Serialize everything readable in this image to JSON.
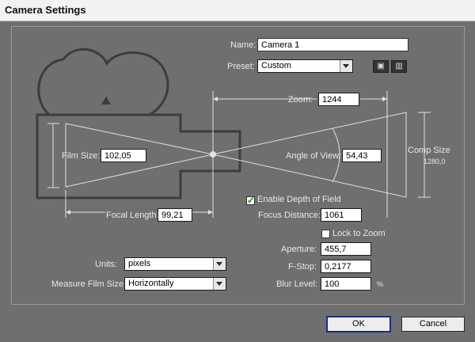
{
  "window": {
    "title": "Camera Settings"
  },
  "name": {
    "label": "Name:",
    "value": "Camera 1"
  },
  "preset": {
    "label": "Preset:",
    "value": "Custom",
    "save_icon": "disk-icon",
    "delete_icon": "trash-icon"
  },
  "zoom": {
    "label": "Zoom:",
    "value": "1244"
  },
  "film_size": {
    "label": "Film Size:",
    "value": "102,05"
  },
  "angle_of_view": {
    "label": "Angle of View:",
    "value": "54,43"
  },
  "comp_size": {
    "label": "Comp Size",
    "value": "1280,0"
  },
  "focal_length": {
    "label": "Focal Length:",
    "value": "99,21"
  },
  "depth_of_field": {
    "label": "Enable Depth of Field",
    "checked": true
  },
  "focus_distance": {
    "label": "Focus Distance:",
    "value": "1061"
  },
  "lock_to_zoom": {
    "label": "Lock to Zoom",
    "checked": false
  },
  "aperture": {
    "label": "Aperture:",
    "value": "455,7"
  },
  "f_stop": {
    "label": "F-Stop:",
    "value": "0,2177"
  },
  "blur_level": {
    "label": "Blur Level:",
    "value": "100",
    "unit": "%"
  },
  "units": {
    "label": "Units:",
    "value": "pixels"
  },
  "measure_film_size": {
    "label": "Measure Film Size:",
    "value": "Horizontally"
  },
  "buttons": {
    "ok": "OK",
    "cancel": "Cancel"
  },
  "colors": {
    "window_bg": "#6f6f6f",
    "diagram_line": "#3c3c3c",
    "guide_line": "#e0e0e0",
    "focus_ring": "#1c2f9e"
  }
}
